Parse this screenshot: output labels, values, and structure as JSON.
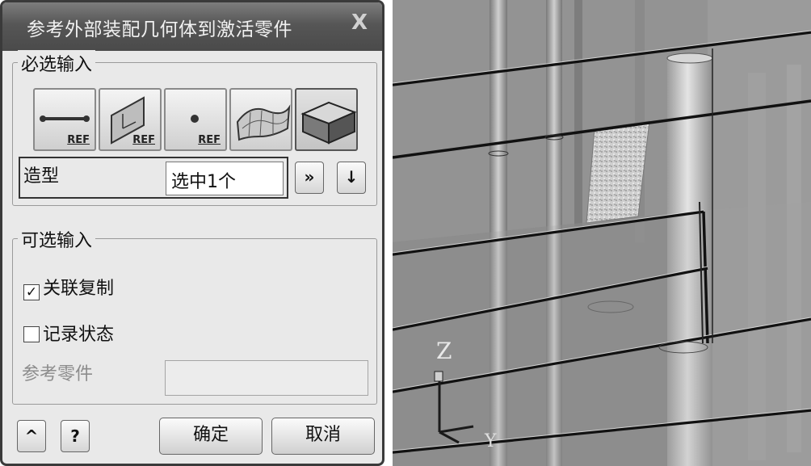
{
  "dialog": {
    "title": "参考外部装配几何体到激活零件",
    "close_symbol": "X",
    "required_group": {
      "title": "必选输入",
      "filter_buttons": [
        {
          "name": "edge",
          "ref": "REF",
          "icon": "edge-ref-icon"
        },
        {
          "name": "face",
          "ref": "REF",
          "icon": "face-ref-icon"
        },
        {
          "name": "point",
          "ref": "REF",
          "icon": "point-ref-icon"
        },
        {
          "name": "surface",
          "icon": "surface-icon"
        },
        {
          "name": "solid",
          "icon": "solid-icon"
        }
      ],
      "shape_label": "造型",
      "shape_value": "选中1个",
      "expand_symbol": "»",
      "down_symbol": "↓"
    },
    "optional_group": {
      "title": "可选输入",
      "associative_copy": {
        "label": "关联复制",
        "checked": true,
        "check_symbol": "✓"
      },
      "record_state": {
        "label": "记录状态",
        "checked": false
      },
      "reference_part_label": "参考零件"
    },
    "footer": {
      "collapse_symbol": "^",
      "help_symbol": "?",
      "ok_label": "确定",
      "cancel_label": "取消"
    }
  },
  "viewport": {
    "axis_z": "Z",
    "axis_y": "Y"
  }
}
